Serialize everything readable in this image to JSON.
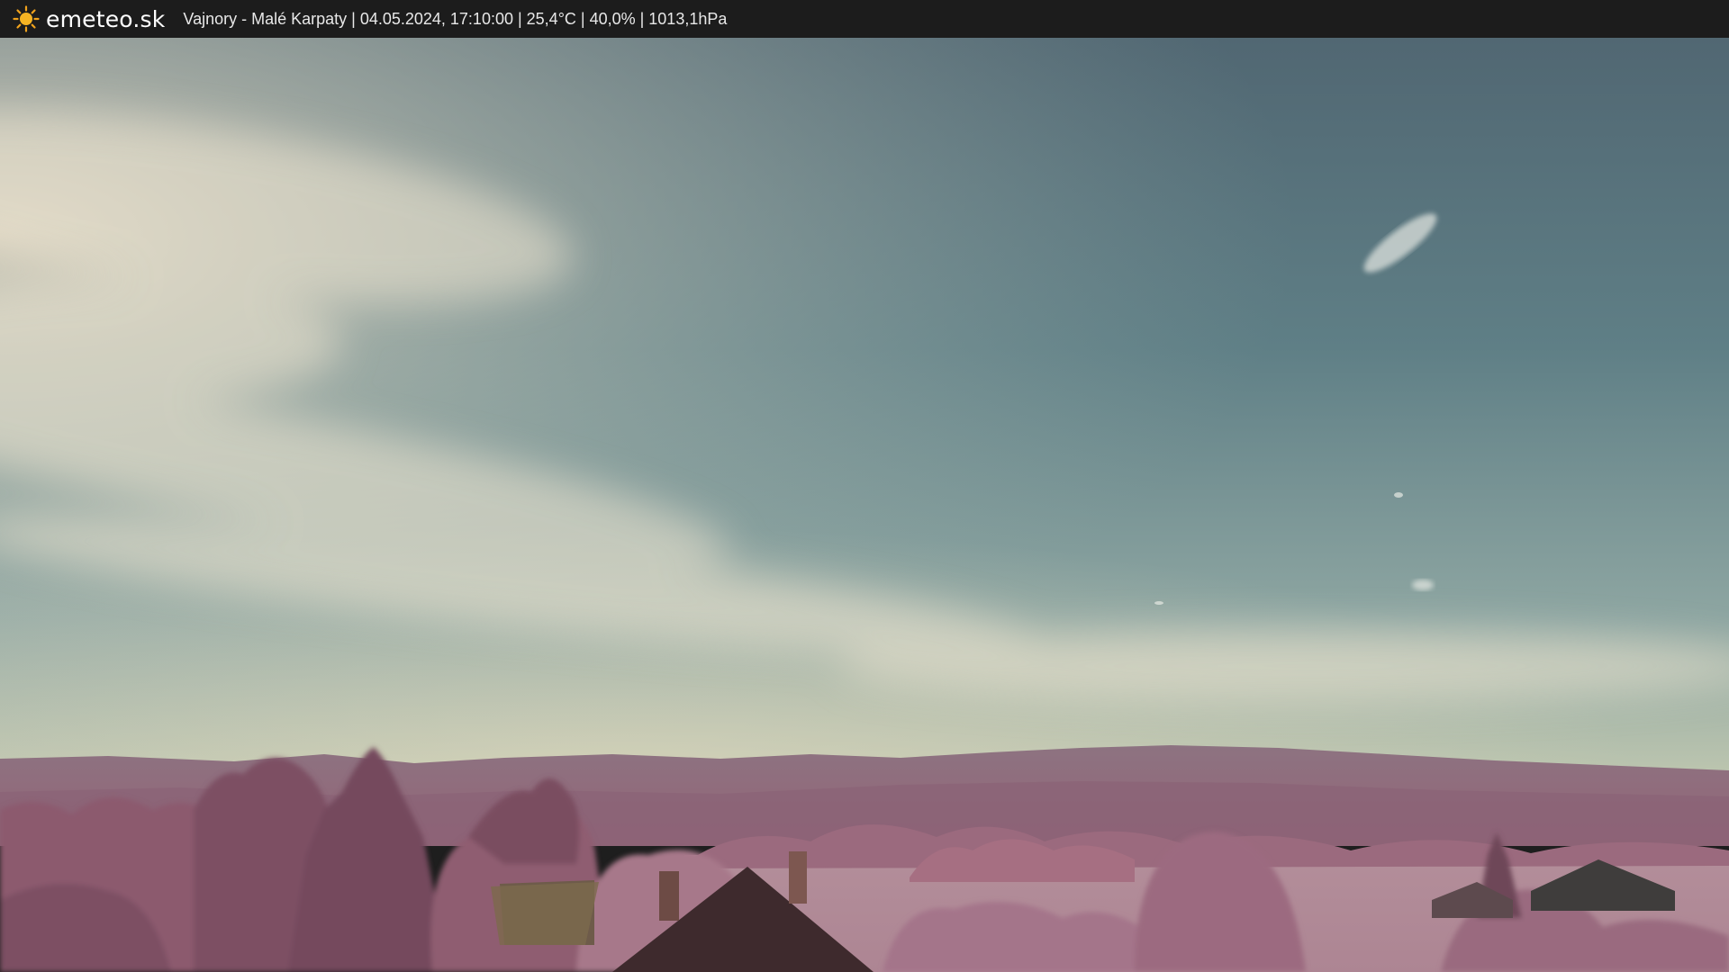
{
  "header": {
    "site_name": "emeteo.sk",
    "logo_icon": "sun-icon",
    "caption": "Vajnory - Malé Karpaty | 04.05.2024, 17:10:00 | 25,4°C | 40,0% | 1013,1hPa"
  },
  "image": {
    "subject": "infrared webcam view",
    "colors": {
      "sky_top": "#526a77",
      "sky_horizon": "#b5c0ad",
      "hills": "#8f6a7c",
      "field": "#b48c99",
      "foliage": "#8c5c70",
      "roof": "#3d2a2c"
    }
  }
}
